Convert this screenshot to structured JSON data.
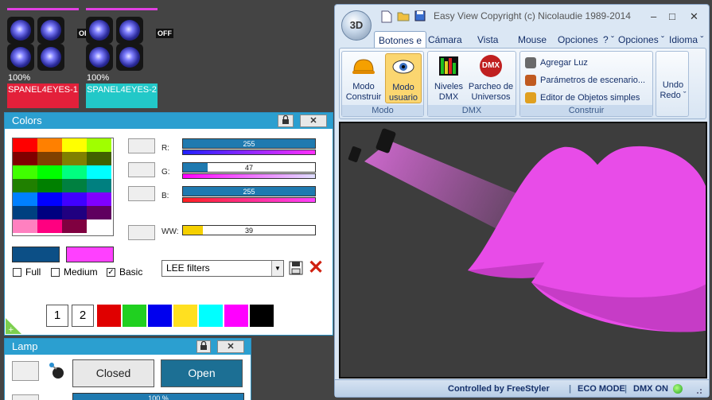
{
  "fixtures": [
    {
      "percent": "100%",
      "name": "SPANEL4EYES-1",
      "off": "OFF",
      "color": "#e3203a"
    },
    {
      "percent": "100%",
      "name": "SPANEL4EYES-2",
      "off": "OFF",
      "color": "#22c8c8"
    }
  ],
  "colors_panel": {
    "title": "Colors",
    "swatches": [
      "#ff0000",
      "#ff8000",
      "#ffff00",
      "#a0ff00",
      "#800000",
      "#804000",
      "#808000",
      "#406000",
      "#40ff00",
      "#00ff00",
      "#00ff80",
      "#00ffff",
      "#208000",
      "#008000",
      "#008040",
      "#008080",
      "#0080ff",
      "#0000ff",
      "#4000ff",
      "#8000ff",
      "#004080",
      "#000080",
      "#200080",
      "#600060",
      "#ff80c0",
      "#ff0080",
      "#800040",
      "#ffffff"
    ],
    "channels": [
      {
        "label": "R:",
        "value": "255",
        "fraction": 1.0
      },
      {
        "label": "G:",
        "value": "47",
        "fraction": 0.184
      },
      {
        "label": "B:",
        "value": "255",
        "fraction": 1.0
      },
      {
        "label": "WW:",
        "value": "39",
        "fraction": 0.153
      }
    ],
    "color_a": "#0c4f86",
    "color_b": "#ff40ff",
    "checkboxes": [
      {
        "label": "Full",
        "checked": false
      },
      {
        "label": "Medium",
        "checked": false
      },
      {
        "label": "Basic",
        "checked": true
      }
    ],
    "filter_select": "LEE filters",
    "page_buttons": [
      "1",
      "2"
    ],
    "palette": [
      "#e00000",
      "#20d020",
      "#0000ee",
      "#ffe020",
      "#00ffff",
      "#ff00ff",
      "#000000"
    ]
  },
  "lamp_panel": {
    "title": "Lamp",
    "closed_label": "Closed",
    "open_label": "Open",
    "progress_label": "100 %"
  },
  "easy_view": {
    "title": "Easy View   Copyright (c) Nicolaudie 1989-2014",
    "logo": "3D",
    "tabs": [
      "Botones e",
      "Cámara",
      "Vista",
      "Mouse",
      "Opciones",
      "? ˇ",
      "Opciones ˇ",
      "Idioma ˇ"
    ],
    "groups": {
      "modo": {
        "label": "Modo",
        "buttons": [
          {
            "line1": "Modo",
            "line2": "Construir"
          },
          {
            "line1": "Modo",
            "line2": "usuario"
          }
        ]
      },
      "dmx": {
        "label": "DMX",
        "buttons": [
          {
            "line1": "Niveles",
            "line2": "DMX"
          },
          {
            "line1": "Parcheo de",
            "line2": "Universos"
          }
        ],
        "dmx_icon_text": "DMX"
      },
      "construir": {
        "label": "Construir",
        "items": [
          "Agregar Luz",
          "Parámetros de escenario...",
          "Editor de Objetos simples"
        ]
      },
      "undo": {
        "line1": "Undo",
        "line2": "Redo ˇ"
      }
    },
    "status": {
      "controlled": "Controlled by FreeStyler",
      "eco": "ECO MODE",
      "dmx": "DMX ON"
    }
  }
}
